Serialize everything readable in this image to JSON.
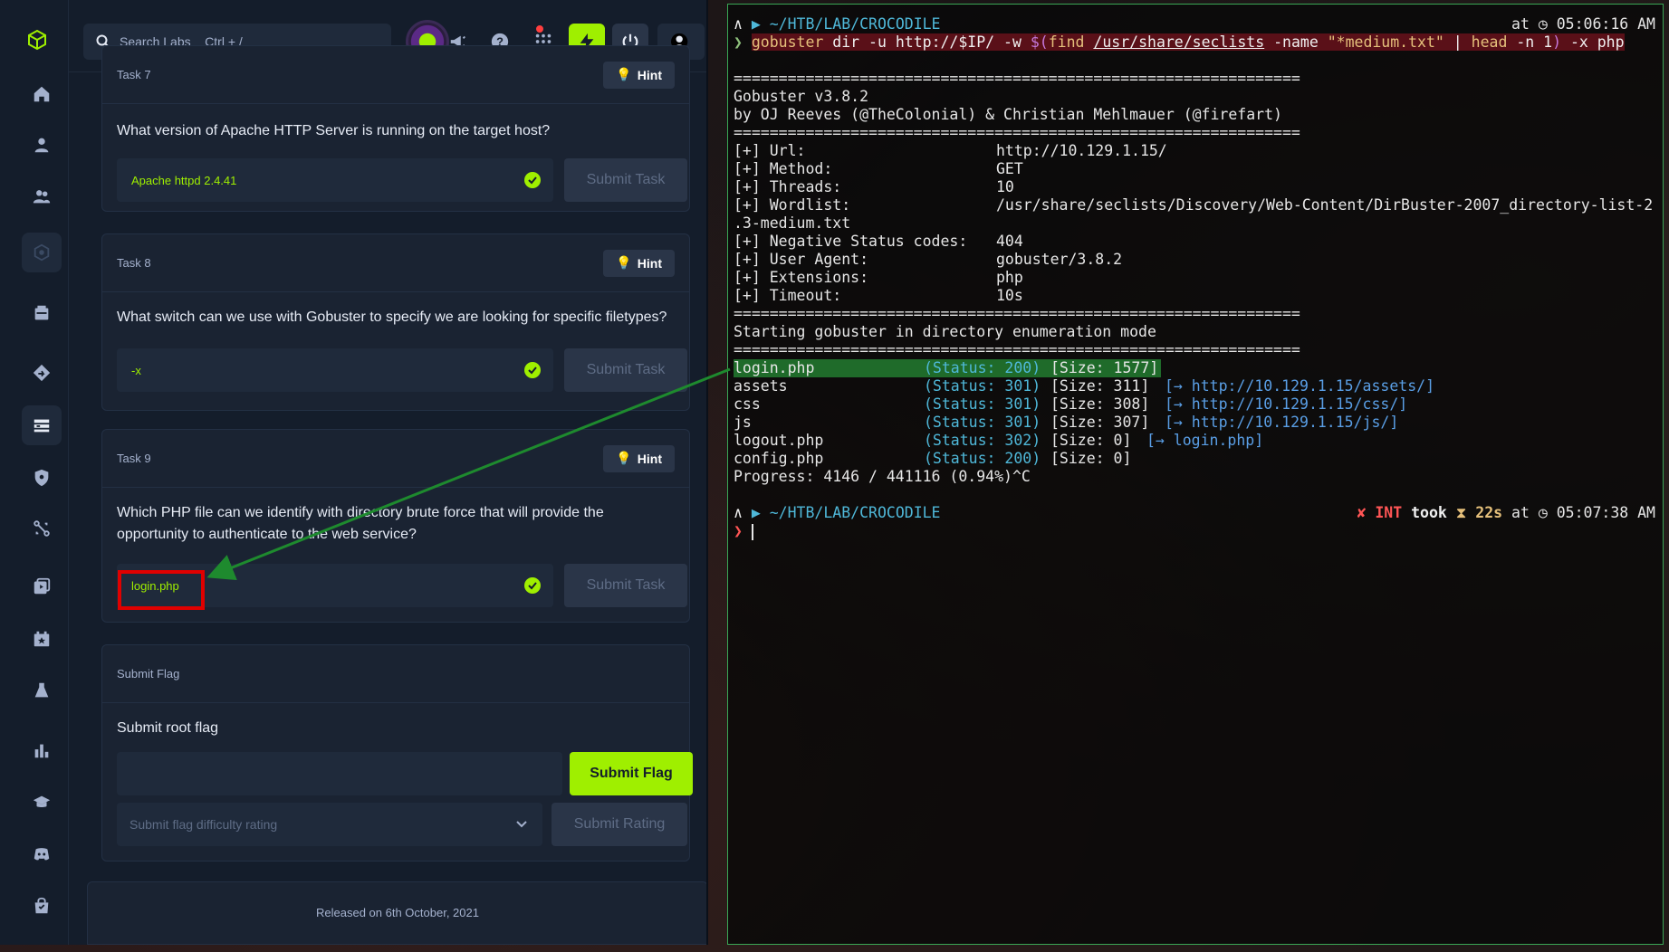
{
  "htb": {
    "search": {
      "placeholder": "Search Labs    Ctrl + /"
    },
    "sidebar": {
      "items": [
        {
          "name": "home-icon"
        },
        {
          "name": "user-icon"
        },
        {
          "name": "users-icon"
        },
        {
          "name": "target-icon"
        },
        {
          "name": "machines-icon"
        },
        {
          "name": "tracks-icon"
        },
        {
          "name": "starting-point-icon"
        },
        {
          "name": "shield-icon"
        },
        {
          "name": "fortress-icon"
        },
        {
          "name": "media-icon"
        },
        {
          "name": "events-icon"
        },
        {
          "name": "lab-flask-icon"
        },
        {
          "name": "stats-icon"
        },
        {
          "name": "academy-icon"
        },
        {
          "name": "discord-icon"
        },
        {
          "name": "shop-icon"
        }
      ]
    },
    "task7": {
      "label": "Task 7",
      "hint": "Hint",
      "question": "What version of Apache HTTP Server is running on the target host?",
      "answer": "Apache httpd 2.4.41",
      "submit": "Submit Task"
    },
    "task8": {
      "label": "Task 8",
      "hint": "Hint",
      "question": "What switch can we use with Gobuster to specify we are looking for specific filetypes?",
      "answer": "-x",
      "submit": "Submit Task"
    },
    "task9": {
      "label": "Task 9",
      "hint": "Hint",
      "question_l1": "Which PHP file can we identify with directory brute force that will provide the",
      "question_l2": "opportunity to authenticate to the web service?",
      "answer": "login.php",
      "submit": "Submit Task"
    },
    "flag": {
      "label": "Submit Flag",
      "title": "Submit root flag",
      "submit": "Submit Flag",
      "rating_placeholder": "Submit flag difficulty rating",
      "rating_submit": "Submit Rating"
    },
    "released": "Released on 6th October, 2021"
  },
  "terminal": {
    "prompt1": {
      "path": "~/HTB/LAB/CROCODILE",
      "time": "at ◷ 05:06:16 AM"
    },
    "command": {
      "cmd": "gobuster",
      "args1": " dir -u http://$IP/ -w ",
      "sub_open": "$(",
      "find": "find",
      "path": "/usr/share/seclists",
      "args2": " -name ",
      "pattern": "\"*medium.txt\"",
      "pipe": " | ",
      "head": "head",
      "args3": " -n 1",
      "sub_close": ")",
      "args4": " -x php"
    },
    "sep": "===============================================================",
    "banner1": "Gobuster v3.8.2",
    "banner2": "by OJ Reeves (@TheColonial) & Christian Mehlmauer (@firefart)",
    "config": [
      {
        "key": "[+] Url:",
        "value": "http://10.129.1.15/"
      },
      {
        "key": "[+] Method:",
        "value": "GET"
      },
      {
        "key": "[+] Threads:",
        "value": "10"
      },
      {
        "key": "[+] Wordlist:",
        "value": "/usr/share/seclists/Discovery/Web-Content/DirBuster-2007_directory-list-2"
      },
      {
        "key": ".3-medium.txt",
        "value": ""
      },
      {
        "key": "[+] Negative Status codes:",
        "value": "404"
      },
      {
        "key": "[+] User Agent:",
        "value": "gobuster/3.8.2"
      },
      {
        "key": "[+] Extensions:",
        "value": "php"
      },
      {
        "key": "[+] Timeout:",
        "value": "10s"
      }
    ],
    "starting": "Starting gobuster in directory enumeration mode",
    "results": [
      {
        "path": "login.php",
        "status": "(Status: 200)",
        "size": "[Size: 1577]",
        "redirect": ""
      },
      {
        "path": "assets",
        "status": "(Status: 301)",
        "size": "[Size: 311]",
        "redirect": "[→ http://10.129.1.15/assets/]"
      },
      {
        "path": "css",
        "status": "(Status: 301)",
        "size": "[Size: 308]",
        "redirect": "[→ http://10.129.1.15/css/]"
      },
      {
        "path": "js",
        "status": "(Status: 301)",
        "size": "[Size: 307]",
        "redirect": "[→ http://10.129.1.15/js/]"
      },
      {
        "path": "logout.php",
        "status": "(Status: 302)",
        "size": "[Size: 0]",
        "redirect": "[→ login.php]"
      },
      {
        "path": "config.php",
        "status": "(Status: 200)",
        "size": "[Size: 0]",
        "redirect": ""
      }
    ],
    "progress": "Progress: 4146 / 441116 (0.94%)^C",
    "prompt2": {
      "path": "~/HTB/LAB/CROCODILE",
      "int": "✘ INT",
      "took": "took",
      "hourglass": "⧗",
      "dur": "22s",
      "at": "at ◷ 05:07:38 AM"
    }
  }
}
